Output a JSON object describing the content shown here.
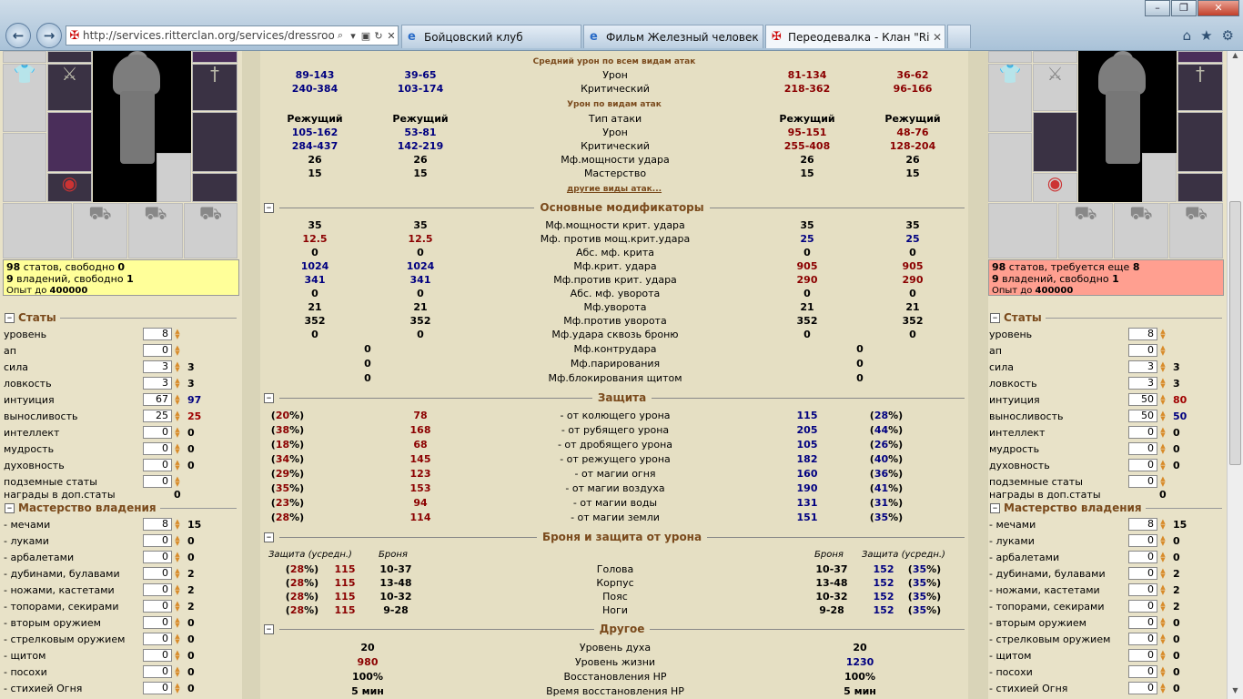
{
  "browser": {
    "url": "http://services.ritterclan.org/services/dressroom",
    "tabs": [
      {
        "label": "Бойцовский клуб"
      },
      {
        "label": "Фильм Железный человек с..."
      },
      {
        "label": "Переодевалка - Клан \"Ritt..."
      }
    ]
  },
  "left": {
    "info": {
      "stats_num": "98",
      "stats_text": " статов, свободно ",
      "stats_free": "0",
      "own_num": "9",
      "own_text": " владений, свободно ",
      "own_free": "1",
      "exp_text": "Опыт до ",
      "exp_val": "400000"
    },
    "stats_title": "Статы",
    "stats": [
      {
        "name": "уровень",
        "val": "8",
        "extra": ""
      },
      {
        "name": "ап",
        "val": "0",
        "extra": ""
      },
      {
        "name": "сила",
        "val": "3",
        "extra": "3"
      },
      {
        "name": "ловкость",
        "val": "3",
        "extra": "3"
      },
      {
        "name": "интуиция",
        "val": "67",
        "extra": "97"
      },
      {
        "name": "выносливость",
        "val": "25",
        "extra": "25"
      },
      {
        "name": "интеллект",
        "val": "0",
        "extra": "0"
      },
      {
        "name": "мудрость",
        "val": "0",
        "extra": "0"
      },
      {
        "name": "духовность",
        "val": "0",
        "extra": "0"
      },
      {
        "name": "подземные статы",
        "val": "0",
        "extra": ""
      }
    ],
    "awards_label": "награды в доп.статы",
    "awards_val": "0",
    "mastery_title": "Мастерство владения",
    "mastery": [
      {
        "name": "- мечами",
        "val": "8",
        "extra": "15"
      },
      {
        "name": "- луками",
        "val": "0",
        "extra": "0"
      },
      {
        "name": "- арбалетами",
        "val": "0",
        "extra": "0"
      },
      {
        "name": "- дубинами, булавами",
        "val": "0",
        "extra": "2"
      },
      {
        "name": "- ножами, кастетами",
        "val": "0",
        "extra": "2"
      },
      {
        "name": "- топорами, секирами",
        "val": "0",
        "extra": "2"
      },
      {
        "name": "- вторым оружием",
        "val": "0",
        "extra": "0"
      },
      {
        "name": "- стрелковым оружием",
        "val": "0",
        "extra": "0"
      },
      {
        "name": "- щитом",
        "val": "0",
        "extra": "0"
      },
      {
        "name": "- посохи",
        "val": "0",
        "extra": "0"
      },
      {
        "name": "- стихией Огня",
        "val": "0",
        "extra": "0"
      }
    ]
  },
  "right": {
    "info": {
      "stats_num": "98",
      "stats_text": " статов, требуется еще ",
      "stats_free": "8",
      "own_num": "9",
      "own_text": " владений, свободно ",
      "own_free": "1",
      "exp_text": "Опыт до ",
      "exp_val": "400000"
    },
    "stats_title": "Статы",
    "stats": [
      {
        "name": "уровень",
        "val": "8",
        "extra": ""
      },
      {
        "name": "ап",
        "val": "0",
        "extra": ""
      },
      {
        "name": "сила",
        "val": "3",
        "extra": "3"
      },
      {
        "name": "ловкость",
        "val": "3",
        "extra": "3"
      },
      {
        "name": "интуиция",
        "val": "50",
        "extra": "80"
      },
      {
        "name": "выносливость",
        "val": "50",
        "extra": "50"
      },
      {
        "name": "интеллект",
        "val": "0",
        "extra": "0"
      },
      {
        "name": "мудрость",
        "val": "0",
        "extra": "0"
      },
      {
        "name": "духовность",
        "val": "0",
        "extra": "0"
      },
      {
        "name": "подземные статы",
        "val": "0",
        "extra": ""
      }
    ],
    "awards_label": "награды в доп.статы",
    "awards_val": "0",
    "mastery_title": "Мастерство владения",
    "mastery": [
      {
        "name": "- мечами",
        "val": "8",
        "extra": "15"
      },
      {
        "name": "- луками",
        "val": "0",
        "extra": "0"
      },
      {
        "name": "- арбалетами",
        "val": "0",
        "extra": "0"
      },
      {
        "name": "- дубинами, булавами",
        "val": "0",
        "extra": "2"
      },
      {
        "name": "- ножами, кастетами",
        "val": "0",
        "extra": "2"
      },
      {
        "name": "- топорами, секирами",
        "val": "0",
        "extra": "2"
      },
      {
        "name": "- вторым оружием",
        "val": "0",
        "extra": "0"
      },
      {
        "name": "- стрелковым оружием",
        "val": "0",
        "extra": "0"
      },
      {
        "name": "- щитом",
        "val": "0",
        "extra": "0"
      },
      {
        "name": "- посохи",
        "val": "0",
        "extra": "0"
      },
      {
        "name": "- стихией Огня",
        "val": "0",
        "extra": "0"
      }
    ]
  },
  "center": {
    "avg_title": "Средний урон по всем видам атак",
    "avg_rows": [
      {
        "a": "89-143",
        "b": "39-65",
        "label": "Урон",
        "c": "81-134",
        "d": "36-62"
      },
      {
        "a": "240-384",
        "b": "103-174",
        "label": "Критический",
        "c": "218-362",
        "d": "96-166"
      }
    ],
    "types_title": "Урон по видам атак",
    "type_rows": [
      {
        "a": "Режущий",
        "b": "Режущий",
        "label": "Тип атаки",
        "c": "Режущий",
        "d": "Режущий"
      },
      {
        "a": "105-162",
        "b": "53-81",
        "label": "Урон",
        "c": "95-151",
        "d": "48-76"
      },
      {
        "a": "284-437",
        "b": "142-219",
        "label": "Критический",
        "c": "255-408",
        "d": "128-204"
      },
      {
        "a": "26",
        "b": "26",
        "label": "Мф.мощности удара",
        "c": "26",
        "d": "26"
      },
      {
        "a": "15",
        "b": "15",
        "label": "Мастерство",
        "c": "15",
        "d": "15"
      }
    ],
    "other_attacks": "другие виды атак...",
    "mods_title": "Основные модификаторы",
    "mods_rows": [
      {
        "a": "35",
        "b": "35",
        "label": "Мф.мощности крит. удара",
        "c": "35",
        "d": "35"
      },
      {
        "a": "12.5",
        "b": "12.5",
        "label": "Мф. против мощ.крит.удара",
        "c": "25",
        "d": "25"
      },
      {
        "a": "0",
        "b": "0",
        "label": "Абс. мф. крита",
        "c": "0",
        "d": "0"
      },
      {
        "a": "1024",
        "b": "1024",
        "label": "Мф.крит. удара",
        "c": "905",
        "d": "905"
      },
      {
        "a": "341",
        "b": "341",
        "label": "Мф.против крит. удара",
        "c": "290",
        "d": "290"
      },
      {
        "a": "0",
        "b": "0",
        "label": "Абс. мф. уворота",
        "c": "0",
        "d": "0"
      },
      {
        "a": "21",
        "b": "21",
        "label": "Мф.уворота",
        "c": "21",
        "d": "21"
      },
      {
        "a": "352",
        "b": "352",
        "label": "Мф.против уворота",
        "c": "352",
        "d": "352"
      },
      {
        "a": "0",
        "b": "0",
        "label": "Мф.удара сквозь броню",
        "c": "0",
        "d": "0"
      }
    ],
    "mods2_rows": [
      {
        "a": "0",
        "label": "Мф.контрудара",
        "c": "0"
      },
      {
        "a": "0",
        "label": "Мф.парирования",
        "c": "0"
      },
      {
        "a": "0",
        "label": "Мф.блокирования щитом",
        "c": "0"
      }
    ],
    "def_title": "Защита",
    "def_rows": [
      {
        "pl": "20",
        "vl": "78",
        "label": "- от колющего урона",
        "vr": "115",
        "pr": "28"
      },
      {
        "pl": "38",
        "vl": "168",
        "label": "- от рубящего урона",
        "vr": "205",
        "pr": "44"
      },
      {
        "pl": "18",
        "vl": "68",
        "label": "- от дробящего урона",
        "vr": "105",
        "pr": "26"
      },
      {
        "pl": "34",
        "vl": "145",
        "label": "- от режущего урона",
        "vr": "182",
        "pr": "40"
      },
      {
        "pl": "29",
        "vl": "123",
        "label": "- от магии огня",
        "vr": "160",
        "pr": "36"
      },
      {
        "pl": "35",
        "vl": "153",
        "label": "- от магии воздуха",
        "vr": "190",
        "pr": "41"
      },
      {
        "pl": "23",
        "vl": "94",
        "label": "- от магии воды",
        "vr": "131",
        "pr": "31"
      },
      {
        "pl": "28",
        "vl": "114",
        "label": "- от магии земли",
        "vr": "151",
        "pr": "35"
      }
    ],
    "armor_title": "Броня и защита от урона",
    "armor_head": {
      "def": "Защита (усредн.)",
      "arm": "Броня"
    },
    "armor_rows": [
      {
        "pl": "28",
        "vl": "115",
        "al": "10-37",
        "label": "Голова",
        "ar": "10-37",
        "vr": "152",
        "pr": "35"
      },
      {
        "pl": "28",
        "vl": "115",
        "al": "13-48",
        "label": "Корпус",
        "ar": "13-48",
        "vr": "152",
        "pr": "35"
      },
      {
        "pl": "28",
        "vl": "115",
        "al": "10-32",
        "label": "Пояс",
        "ar": "10-32",
        "vr": "152",
        "pr": "35"
      },
      {
        "pl": "28",
        "vl": "115",
        "al": "9-28",
        "label": "Ноги",
        "ar": "9-28",
        "vr": "152",
        "pr": "35"
      }
    ],
    "other_title": "Другое",
    "other_rows": [
      {
        "a": "20",
        "label": "Уровень духа",
        "c": "20"
      },
      {
        "a": "980",
        "label": "Уровень жизни",
        "c": "1230"
      },
      {
        "a": "100%",
        "label": "Восстановления HP",
        "c": "100%"
      },
      {
        "a": "5 мин",
        "label": "Время восстановления HP",
        "c": "5 мин"
      }
    ]
  }
}
